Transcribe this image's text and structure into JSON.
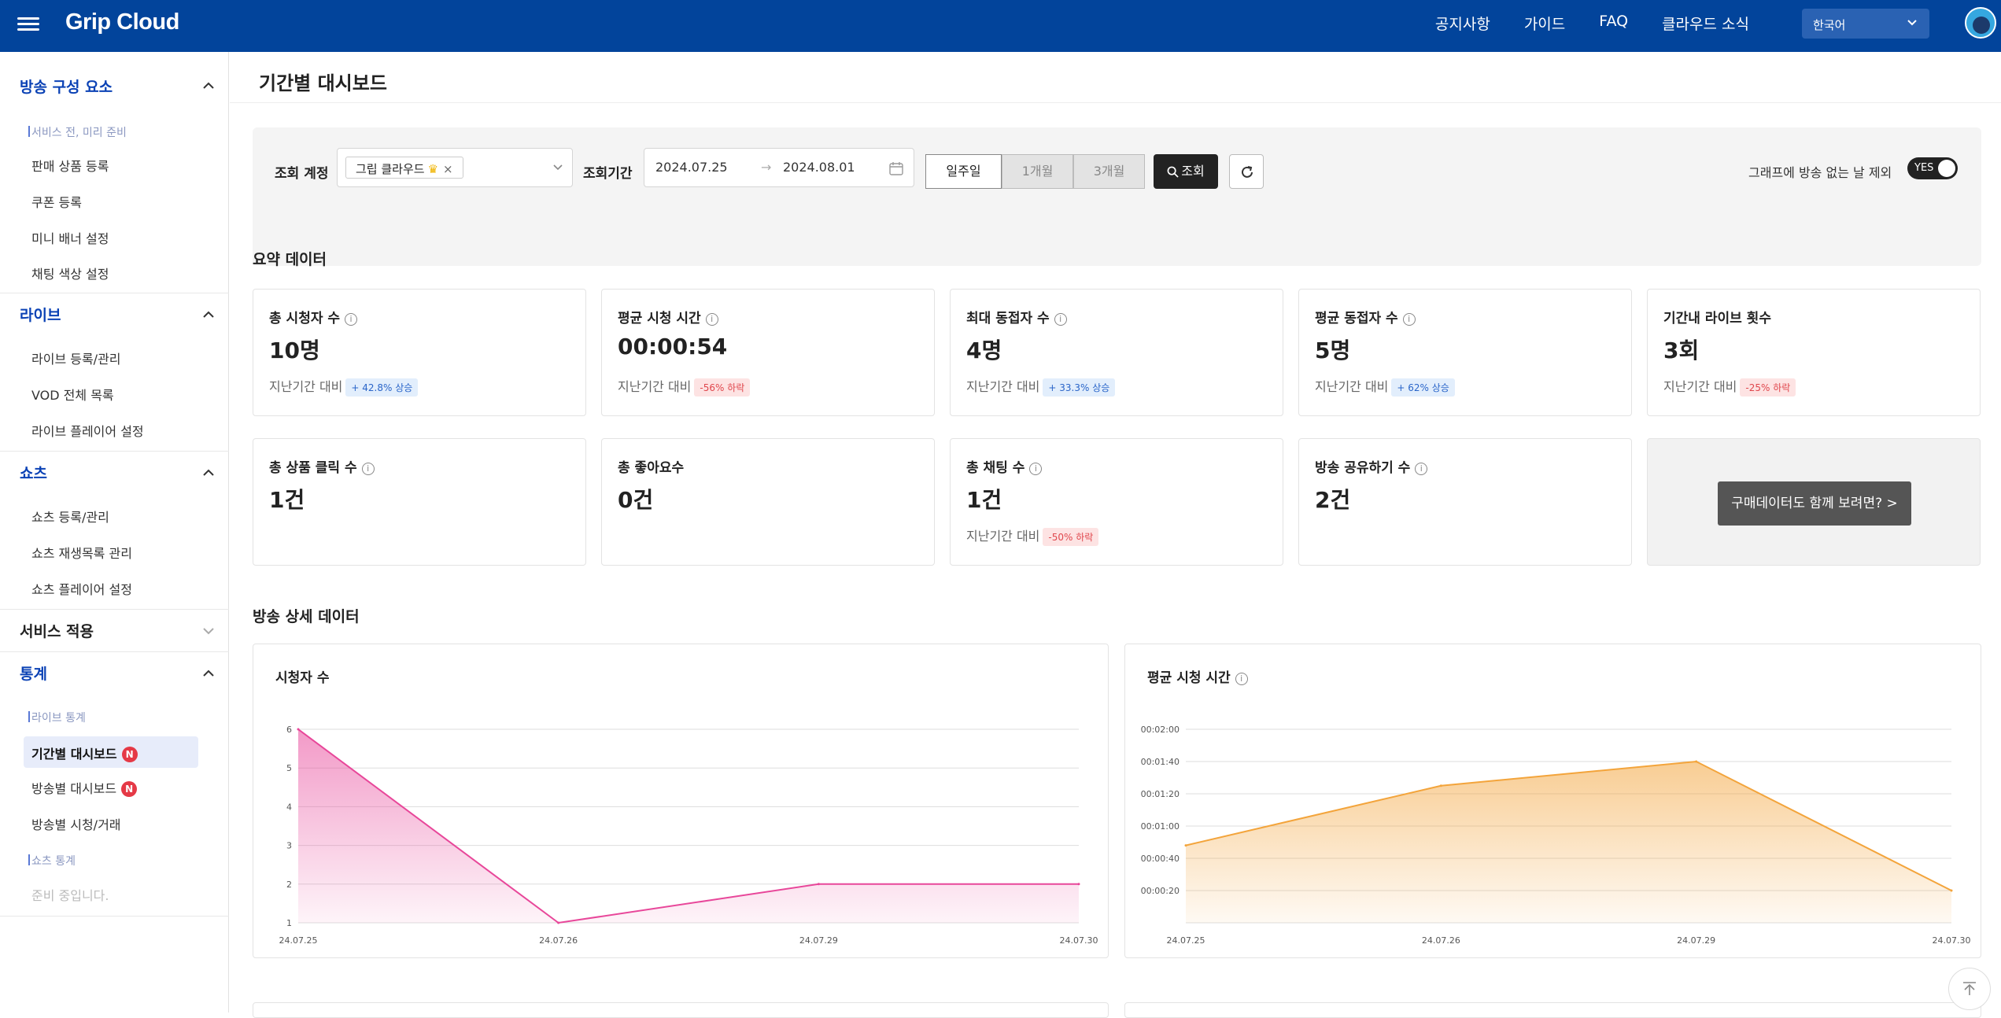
{
  "app": {
    "logo": "Grip Cloud"
  },
  "topnav": [
    "공지사항",
    "가이드",
    "FAQ",
    "클라우드 소식"
  ],
  "language": {
    "selected": "한국어"
  },
  "sidebar": {
    "sections": [
      {
        "title": "방송 구성 요소",
        "expanded": true
      },
      {
        "title": "라이브",
        "expanded": true
      },
      {
        "title": "쇼츠",
        "expanded": true
      },
      {
        "title": "서비스 적용",
        "expanded": false
      },
      {
        "title": "통계",
        "expanded": true
      }
    ],
    "broadcast_sub": "서비스 전, 미리 준비",
    "broadcast_items": [
      "판매 상품 등록",
      "쿠폰 등록",
      "미니 배너 설정",
      "채팅 색상 설정"
    ],
    "live_items": [
      "라이브 등록/관리",
      "VOD 전체 목록",
      "라이브 플레이어 설정"
    ],
    "shorts_items": [
      "쇼츠 등록/관리",
      "쇼츠 재생목록 관리",
      "쇼츠 플레이어 설정"
    ],
    "stats_live_sub": "라이브 통계",
    "stats_items": [
      "기간별 대시보드",
      "방송별 대시보드",
      "방송별 시청/거래"
    ],
    "stats_shorts_sub": "쇼츠 통계",
    "stats_shorts_empty": "준비 중입니다.",
    "new_badge": "N"
  },
  "page": {
    "title": "기간별 대시보드"
  },
  "filter": {
    "account_label": "조회 계정",
    "account_chip": "그립 클라우드",
    "crown_icon": "♛",
    "remove_icon": "×",
    "period_label": "조회기간",
    "start_date": "2024.07.25",
    "arrow": "→",
    "end_date": "2024.08.01",
    "range_buttons": [
      {
        "label": "일주일",
        "active": true
      },
      {
        "label": "1개월",
        "active": false
      },
      {
        "label": "3개월",
        "active": false
      }
    ],
    "search_label": "조회",
    "exclude_label": "그래프에 방송 없는 날 제외",
    "toggle_label": "YES"
  },
  "summary": {
    "title": "요약 데이터",
    "compare_label": "지난기간 대비",
    "cards": [
      {
        "title": "총 시청자 수",
        "info": true,
        "value": "10명",
        "change": "+ 42.8% 상승",
        "dir": "up"
      },
      {
        "title": "평균 시청 시간",
        "info": true,
        "value": "00:00:54",
        "change": "-56% 하락",
        "dir": "down"
      },
      {
        "title": "최대 동접자 수",
        "info": true,
        "value": "4명",
        "change": "+ 33.3% 상승",
        "dir": "up"
      },
      {
        "title": "평균 동접자 수",
        "info": true,
        "value": "5명",
        "change": "+ 62% 상승",
        "dir": "up"
      },
      {
        "title": "기간내 라이브 횟수",
        "info": false,
        "value": "3회",
        "change": "-25% 하락",
        "dir": "down"
      },
      {
        "title": "총 상품 클릭 수",
        "info": true,
        "value": "1건",
        "change": "",
        "dir": ""
      },
      {
        "title": "총 좋아요수",
        "info": false,
        "value": "0건",
        "change": "",
        "dir": ""
      },
      {
        "title": "총 채팅 수",
        "info": true,
        "value": "1건",
        "change": "-50% 하락",
        "dir": "down"
      },
      {
        "title": "방송 공유하기 수",
        "info": true,
        "value": "2건",
        "change": "",
        "dir": ""
      }
    ],
    "promo_button": "구매데이터도 함께 보려면? >"
  },
  "detail": {
    "title": "방송 상세 데이터"
  },
  "colors": {
    "brand": "#02449b",
    "viewers_line": "#e8479a",
    "watch_line": "#f3a43b"
  },
  "chart_data": [
    {
      "type": "area",
      "title": "시청자 수",
      "x": [
        "24.07.25",
        "24.07.26",
        "24.07.29",
        "24.07.30"
      ],
      "series": [
        {
          "values": [
            6,
            1,
            2,
            2
          ]
        }
      ],
      "ylim": [
        1,
        6
      ],
      "yticks": [
        "1",
        "2",
        "3",
        "4",
        "5",
        "6"
      ],
      "grid": true
    },
    {
      "type": "area",
      "title": "평균 시청 시간",
      "x": [
        "24.07.25",
        "24.07.26",
        "24.07.29",
        "24.07.30"
      ],
      "series": [
        {
          "values": [
            48,
            85,
            100,
            20
          ]
        }
      ],
      "ylim": [
        0,
        120
      ],
      "yticks": [
        "",
        "00:00:20",
        "00:00:40",
        "00:01:00",
        "00:01:20",
        "00:01:40",
        "00:02:00"
      ],
      "grid": true
    }
  ]
}
